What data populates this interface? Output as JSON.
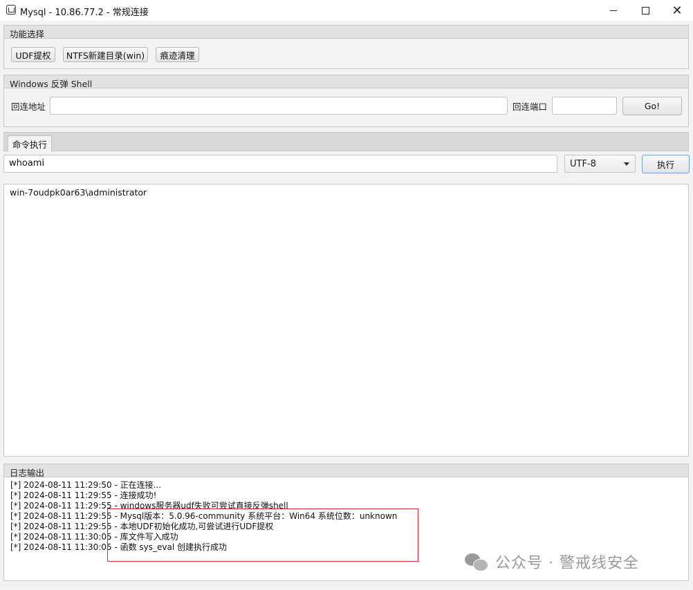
{
  "window": {
    "title": "Mysql - 10.86.77.2 - 常规连接",
    "controls": {
      "minimize": "",
      "maximize": "",
      "close": "✕"
    }
  },
  "function_group": {
    "header": "功能选择",
    "buttons": [
      "UDF提权",
      "NTFS新建目录(win)",
      "痕迹清理"
    ]
  },
  "shell_group": {
    "header": "Windows 反弹 Shell",
    "address_label": "回连地址",
    "address_value": "",
    "port_label": "回连端口",
    "port_value": "",
    "go_label": "Go!"
  },
  "command": {
    "tab_label": "命令执行",
    "input_value": "whoami",
    "encoding": "UTF-8",
    "execute_label": "执行",
    "output": "win-7oudpk0ar63\\administrator"
  },
  "log": {
    "header": "日志输出",
    "lines": [
      "[*] 2024-08-11 11:29:50 - 正在连接...",
      "[*] 2024-08-11 11:29:55 - 连接成功!",
      "[*] 2024-08-11 11:29:55 - windows服务器udf失败可尝试直接反弹shell",
      "[*] 2024-08-11 11:29:55 - Mysql版本：5.0.96-community 系统平台：Win64 系统位数：unknown",
      "[*] 2024-08-11 11:29:55 - 本地UDF初始化成功,可尝试进行UDF提权",
      "[*] 2024-08-11 11:30:05 - 库文件写入成功",
      "[*] 2024-08-11 11:30:05 - 函数 sys_eval 创建执行成功"
    ]
  },
  "watermark": "公众号 · 警戒线安全",
  "colors": {
    "highlight_box": "#d42a2a"
  }
}
